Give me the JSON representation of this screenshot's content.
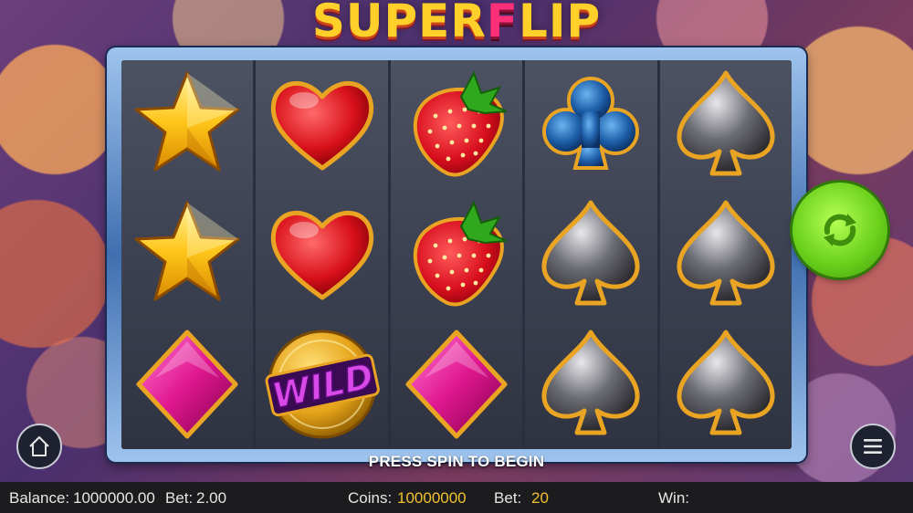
{
  "game": {
    "logo_part1": "SUPER",
    "logo_flip_letter": "F",
    "logo_part2": "LIP"
  },
  "reels": [
    [
      "star",
      "star",
      "diamond"
    ],
    [
      "heart",
      "heart",
      "wild"
    ],
    [
      "strawberry",
      "strawberry",
      "diamond"
    ],
    [
      "club",
      "spade",
      "spade"
    ],
    [
      "spade",
      "spade",
      "spade"
    ]
  ],
  "symbols": {
    "wild_label": "WILD"
  },
  "message": "PRESS SPIN TO BEGIN",
  "status": {
    "balance_label": "Balance:",
    "balance_value": "1000000.00",
    "bet_label": "Bet:",
    "bet_value": "2.00",
    "coins_label": "Coins:",
    "coins_value": "10000000",
    "bet_coins_label": "Bet:",
    "bet_coins_value": "20",
    "win_label": "Win:"
  },
  "controls": {
    "spin_icon": "refresh-icon",
    "home_icon": "home-icon",
    "menu_icon": "hamburger-menu-icon"
  },
  "colors": {
    "spin_green": "#6cd21c",
    "coins_yellow": "#f2c12e",
    "logo_yellow": "#ffd02a",
    "logo_pink": "#ff2f7a"
  }
}
